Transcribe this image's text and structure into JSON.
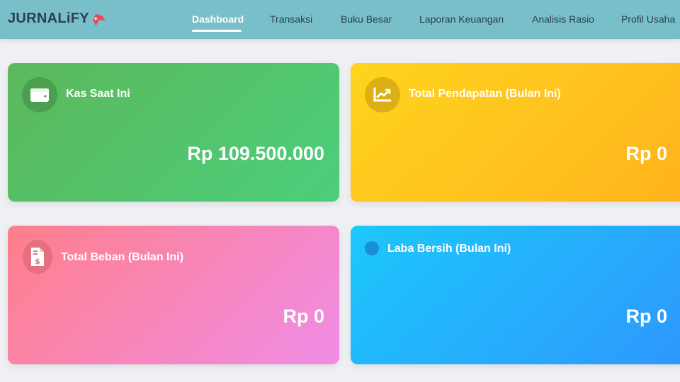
{
  "brand": {
    "name": "JURNALiFY",
    "logo_icon": "bookmark-icon"
  },
  "nav": {
    "items": [
      {
        "label": "Dashboard",
        "active": true
      },
      {
        "label": "Transaksi",
        "active": false
      },
      {
        "label": "Buku Besar",
        "active": false
      },
      {
        "label": "Laporan Keuangan",
        "active": false
      },
      {
        "label": "Analisis Rasio",
        "active": false
      },
      {
        "label": "Profil Usaha",
        "active": false
      }
    ]
  },
  "cards": [
    {
      "title": "Kas Saat Ini",
      "value": "Rp 109.500.000",
      "icon": "wallet-icon",
      "color": "#5cb85c"
    },
    {
      "title": "Total Pendapatan (Bulan Ini)",
      "value": "Rp 0",
      "icon": "chart-line-icon",
      "color": "#ffc61e"
    },
    {
      "title": "Total Beban (Bulan Ini)",
      "value": "Rp 0",
      "icon": "invoice-dollar-icon",
      "color": "#f784b4"
    },
    {
      "title": "Laba Bersih (Bulan Ini)",
      "value": "Rp 0",
      "icon": "dot-icon",
      "color": "#25b1fc"
    }
  ]
}
